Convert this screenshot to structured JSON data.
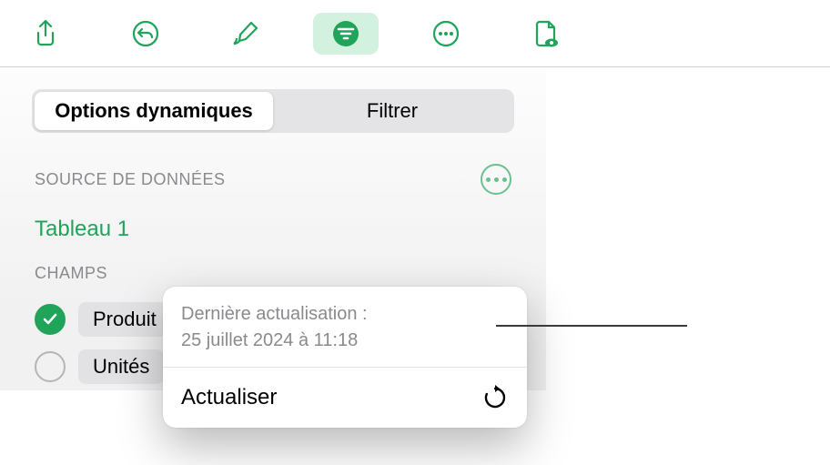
{
  "toolbar": {
    "icons": [
      "share-icon",
      "undo-icon",
      "brush-icon",
      "filter-icon",
      "more-icon",
      "doc-eye-icon"
    ],
    "activeIndex": 3
  },
  "segmented": {
    "items": [
      "Options dynamiques",
      "Filtrer"
    ],
    "selected": 0
  },
  "dataSource": {
    "sectionLabel": "SOURCE DE DONNÉES",
    "tableName": "Tableau 1"
  },
  "fields": {
    "sectionLabel": "CHAMPS",
    "items": [
      {
        "label": "Produit",
        "checked": true
      },
      {
        "label": "Unités",
        "checked": false
      }
    ]
  },
  "popover": {
    "lastUpdateLabel": "Dernière actualisation :",
    "lastUpdateValue": "25 juillet 2024 à 11:18",
    "refreshLabel": "Actualiser"
  }
}
